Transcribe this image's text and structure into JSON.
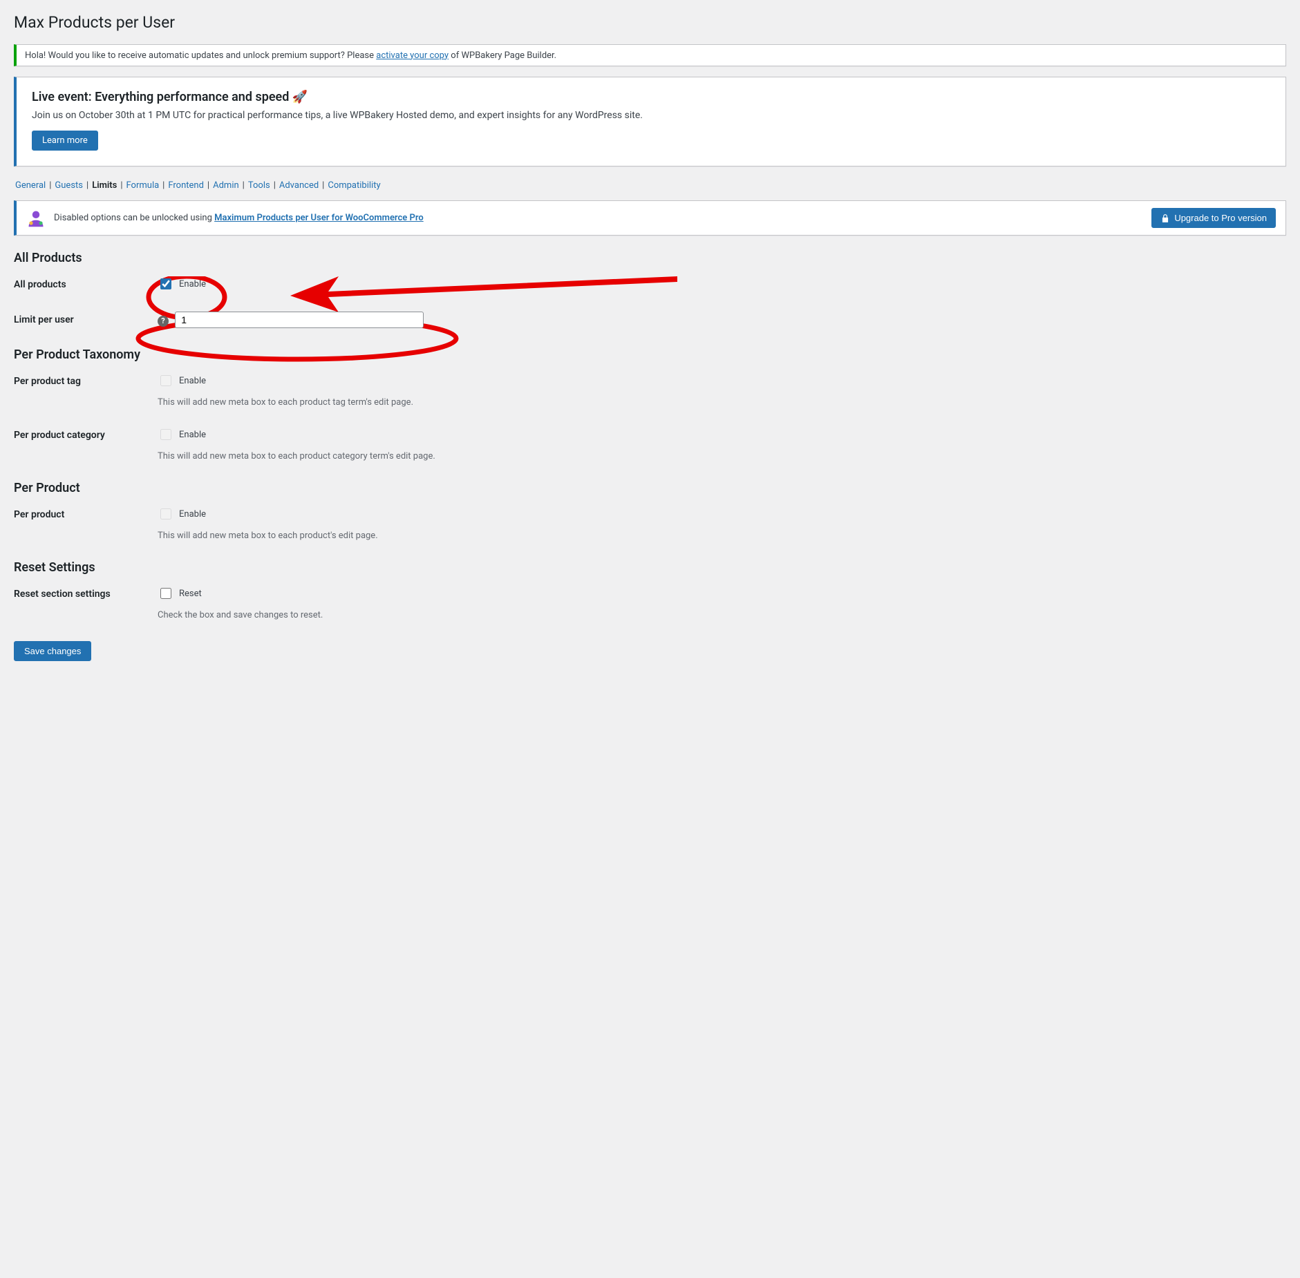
{
  "page_title": "Max Products per User",
  "notice1": {
    "prefix": "Hola! Would you like to receive automatic updates and unlock premium support? Please",
    "link": "activate your copy",
    "suffix": "of WPBakery Page Builder."
  },
  "event": {
    "title": "Live event: Everything performance and speed 🚀",
    "body": "Join us on October 30th at 1 PM UTC for practical performance tips, a live WPBakery Hosted demo, and expert insights for any WordPress site.",
    "button": "Learn more"
  },
  "nav": {
    "items": [
      "General",
      "Guests",
      "Limits",
      "Formula",
      "Frontend",
      "Admin",
      "Tools",
      "Advanced",
      "Compatibility"
    ],
    "active_index": 2
  },
  "pro": {
    "text": "Disabled options can be unlocked using",
    "link": "Maximum Products per User for WooCommerce Pro",
    "button": "Upgrade to Pro version"
  },
  "sections": {
    "all_products": {
      "heading": "All Products",
      "row1": {
        "label": "All products",
        "checkbox_label": "Enable",
        "checked": true
      },
      "row2": {
        "label": "Limit per user",
        "value": "1"
      }
    },
    "taxonomy": {
      "heading": "Per Product Taxonomy",
      "row1": {
        "label": "Per product tag",
        "checkbox_label": "Enable",
        "checked": false,
        "desc": "This will add new meta box to each product tag term's edit page."
      },
      "row2": {
        "label": "Per product category",
        "checkbox_label": "Enable",
        "checked": false,
        "desc": "This will add new meta box to each product category term's edit page."
      }
    },
    "per_product": {
      "heading": "Per Product",
      "row1": {
        "label": "Per product",
        "checkbox_label": "Enable",
        "checked": false,
        "desc": "This will add new meta box to each product's edit page."
      }
    },
    "reset": {
      "heading": "Reset Settings",
      "row1": {
        "label": "Reset section settings",
        "checkbox_label": "Reset",
        "checked": false,
        "desc": "Check the box and save changes to reset."
      }
    }
  },
  "save_button": "Save changes"
}
